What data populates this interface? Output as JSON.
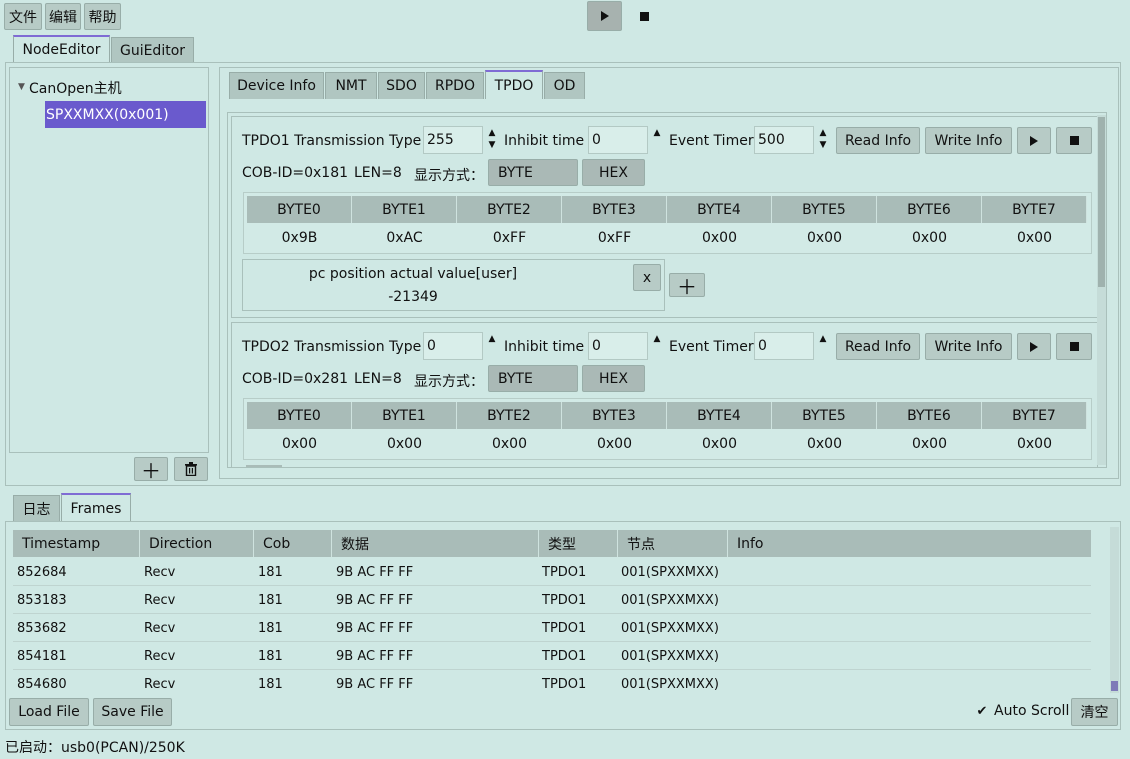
{
  "menu": {
    "file": "文件",
    "edit": "编辑",
    "help": "帮助"
  },
  "top_tabs": {
    "node_editor": "NodeEditor",
    "gui_editor": "GuiEditor"
  },
  "tree": {
    "root": "CanOpen主机",
    "node": "SPXXMXX(0x001)"
  },
  "inner_tabs": [
    "Device Info",
    "NMT",
    "SDO",
    "RPDO",
    "TPDO",
    "OD"
  ],
  "labels": {
    "inhibit": "Inhibit time",
    "event": "Event Timer",
    "read": "Read Info",
    "write": "Write Info",
    "display_mode": "显示方式：",
    "byte_btn": "BYTE",
    "hex_btn": "HEX",
    "len": "LEN=8",
    "close_x": "x"
  },
  "tpdo1": {
    "title": "TPDO1 Transmission Type",
    "type_value": "255",
    "inhibit_value": "0",
    "event_value": "500",
    "cob_id": "COB-ID=0x181",
    "byte_headers": [
      "BYTE0",
      "BYTE1",
      "BYTE2",
      "BYTE3",
      "BYTE4",
      "BYTE5",
      "BYTE6",
      "BYTE7"
    ],
    "byte_values": [
      "0x9B",
      "0xAC",
      "0xFF",
      "0xFF",
      "0x00",
      "0x00",
      "0x00",
      "0x00"
    ],
    "mapping_name": "pc position actual value[user]",
    "mapping_value": "-21349"
  },
  "tpdo2": {
    "title": "TPDO2 Transmission Type",
    "type_value": "0",
    "inhibit_value": "0",
    "event_value": "0",
    "cob_id": "COB-ID=0x281",
    "byte_headers": [
      "BYTE0",
      "BYTE1",
      "BYTE2",
      "BYTE3",
      "BYTE4",
      "BYTE5",
      "BYTE6",
      "BYTE7"
    ],
    "byte_values": [
      "0x00",
      "0x00",
      "0x00",
      "0x00",
      "0x00",
      "0x00",
      "0x00",
      "0x00"
    ]
  },
  "bottom_tabs": {
    "log": "日志",
    "frames": "Frames"
  },
  "frames": {
    "columns": [
      "Timestamp",
      "Direction",
      "Cob",
      "数据",
      "类型",
      "节点",
      "Info"
    ],
    "rows": [
      [
        "852684",
        "Recv",
        "181",
        "9B AC FF FF",
        "TPDO1",
        "001(SPXXMXX)",
        ""
      ],
      [
        "853183",
        "Recv",
        "181",
        "9B AC FF FF",
        "TPDO1",
        "001(SPXXMXX)",
        ""
      ],
      [
        "853682",
        "Recv",
        "181",
        "9B AC FF FF",
        "TPDO1",
        "001(SPXXMXX)",
        ""
      ],
      [
        "854181",
        "Recv",
        "181",
        "9B AC FF FF",
        "TPDO1",
        "001(SPXXMXX)",
        ""
      ],
      [
        "854680",
        "Recv",
        "181",
        "9B AC FF FF",
        "TPDO1",
        "001(SPXXMXX)",
        ""
      ]
    ]
  },
  "bottom_buttons": {
    "load": "Load File",
    "save": "Save File",
    "auto_scroll": "Auto Scroll",
    "clear": "清空"
  },
  "status": "已启动：usb0(PCAN)/250K",
  "colors": {
    "background": "#cfe8e4",
    "selection": "#6a5acd",
    "tab_accent": "#7f6bd4"
  }
}
